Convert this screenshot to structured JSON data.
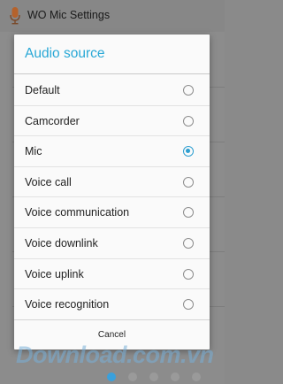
{
  "app": {
    "title": "WO Mic Settings",
    "icon": "microphone-icon"
  },
  "dialog": {
    "title": "Audio source",
    "options": [
      {
        "label": "Default",
        "selected": false
      },
      {
        "label": "Camcorder",
        "selected": false
      },
      {
        "label": "Mic",
        "selected": true
      },
      {
        "label": "Voice call",
        "selected": false
      },
      {
        "label": "Voice communication",
        "selected": false
      },
      {
        "label": "Voice downlink",
        "selected": false
      },
      {
        "label": "Voice uplink",
        "selected": false
      },
      {
        "label": "Voice recognition",
        "selected": false
      }
    ],
    "cancel_label": "Cancel"
  },
  "watermark": {
    "text": "Download.com.vn"
  },
  "colors": {
    "accent": "#29a8d6",
    "radio_selected": "#2e9fd0",
    "scrim": "#878787"
  }
}
